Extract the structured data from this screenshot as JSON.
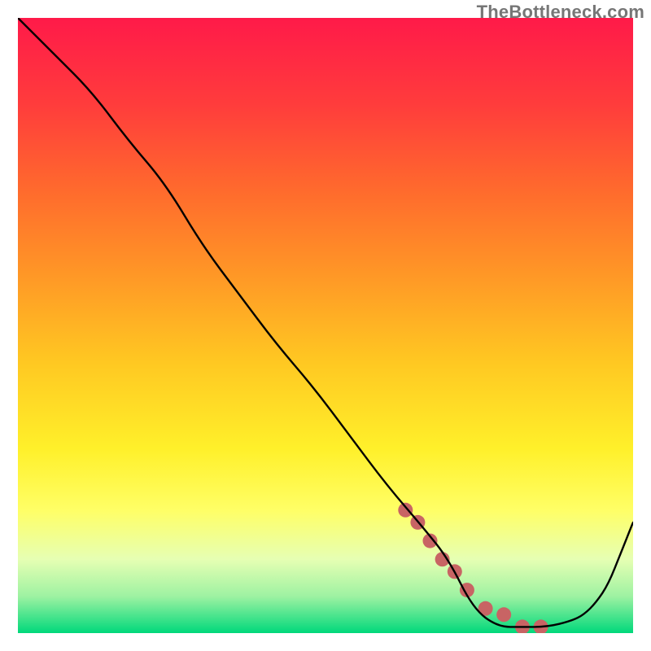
{
  "watermark": {
    "text": "TheBottleneck.com"
  },
  "chart_data": {
    "type": "line",
    "title": "",
    "xlabel": "",
    "ylabel": "",
    "xlim": [
      0,
      100
    ],
    "ylim": [
      0,
      100
    ],
    "grid": false,
    "legend": false,
    "background_gradient": {
      "stops": [
        {
          "offset": 0.0,
          "color": "#ff1a49"
        },
        {
          "offset": 0.14,
          "color": "#ff3c3c"
        },
        {
          "offset": 0.28,
          "color": "#ff6a2d"
        },
        {
          "offset": 0.42,
          "color": "#ff9826"
        },
        {
          "offset": 0.56,
          "color": "#ffc822"
        },
        {
          "offset": 0.7,
          "color": "#fff02a"
        },
        {
          "offset": 0.8,
          "color": "#ffff66"
        },
        {
          "offset": 0.88,
          "color": "#e6ffb3"
        },
        {
          "offset": 0.94,
          "color": "#9ef2a2"
        },
        {
          "offset": 1.0,
          "color": "#00d87b"
        }
      ]
    },
    "series": [
      {
        "name": "bottleneck-curve",
        "color": "#000000",
        "x": [
          0,
          6,
          12,
          18,
          24,
          30,
          36,
          42,
          48,
          54,
          60,
          66,
          70,
          74,
          78,
          82,
          86,
          90,
          92,
          94,
          96,
          98,
          100
        ],
        "y": [
          100,
          94,
          88,
          80,
          73,
          63,
          55,
          47,
          40,
          32,
          24,
          17,
          12,
          4,
          1,
          1,
          1,
          2,
          3,
          5,
          8,
          13,
          18
        ]
      },
      {
        "name": "highlight-dots",
        "type": "scatter",
        "color": "#c86464",
        "radius": 9,
        "x": [
          63,
          65,
          67,
          69,
          71,
          73,
          76,
          79,
          82,
          85
        ],
        "y": [
          20,
          18,
          15,
          12,
          10,
          7,
          4,
          3,
          1,
          1
        ]
      }
    ]
  }
}
